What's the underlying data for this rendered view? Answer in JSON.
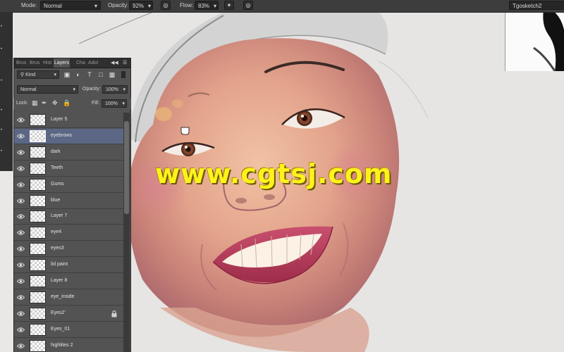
{
  "options_bar": {
    "mode_label": "Mode:",
    "mode_value": "Normal",
    "opacity_label": "Opacity:",
    "opacity_value": "92%",
    "flow_label": "Flow:",
    "flow_value": "83%",
    "document_name": "Tgosketch2"
  },
  "panel": {
    "tabs": [
      "Brus",
      "Brus",
      "Hist",
      "Layers",
      "Cha",
      "Adol"
    ],
    "active_tab": "Layers",
    "filter_kind": "Kind",
    "blend_mode": "Normal",
    "opacity_label": "Opacity:",
    "opacity_value": "100%",
    "lock_label": "Lock:",
    "fill_label": "Fill:",
    "fill_value": "100%",
    "layers": [
      {
        "name": "Layer 5",
        "visible": true,
        "selected": false,
        "locked": false
      },
      {
        "name": "eyebrows",
        "visible": true,
        "selected": true,
        "locked": false
      },
      {
        "name": "dark",
        "visible": true,
        "selected": false,
        "locked": false
      },
      {
        "name": "Teeth",
        "visible": true,
        "selected": false,
        "locked": false
      },
      {
        "name": "Gums",
        "visible": true,
        "selected": false,
        "locked": false
      },
      {
        "name": "blue",
        "visible": true,
        "selected": false,
        "locked": false
      },
      {
        "name": "Layer 7",
        "visible": true,
        "selected": false,
        "locked": false
      },
      {
        "name": "eye4",
        "visible": true,
        "selected": false,
        "locked": false
      },
      {
        "name": "eyes3",
        "visible": true,
        "selected": false,
        "locked": false
      },
      {
        "name": "lid paint",
        "visible": true,
        "selected": false,
        "locked": false
      },
      {
        "name": "Layer 8",
        "visible": true,
        "selected": false,
        "locked": false
      },
      {
        "name": "eye_inside",
        "visible": true,
        "selected": false,
        "locked": false
      },
      {
        "name": "Eyes2'",
        "visible": true,
        "selected": false,
        "locked": true
      },
      {
        "name": "Eyes_01",
        "visible": true,
        "selected": false,
        "locked": false
      },
      {
        "name": "highlites 2",
        "visible": true,
        "selected": false,
        "locked": false
      }
    ]
  },
  "watermark": "www.cgtsj.com",
  "colors": {
    "panel_bg": "#535353",
    "selected_row": "#5b6785",
    "options_bar_bg": "#3d3d3d",
    "watermark": "#fff21c"
  }
}
